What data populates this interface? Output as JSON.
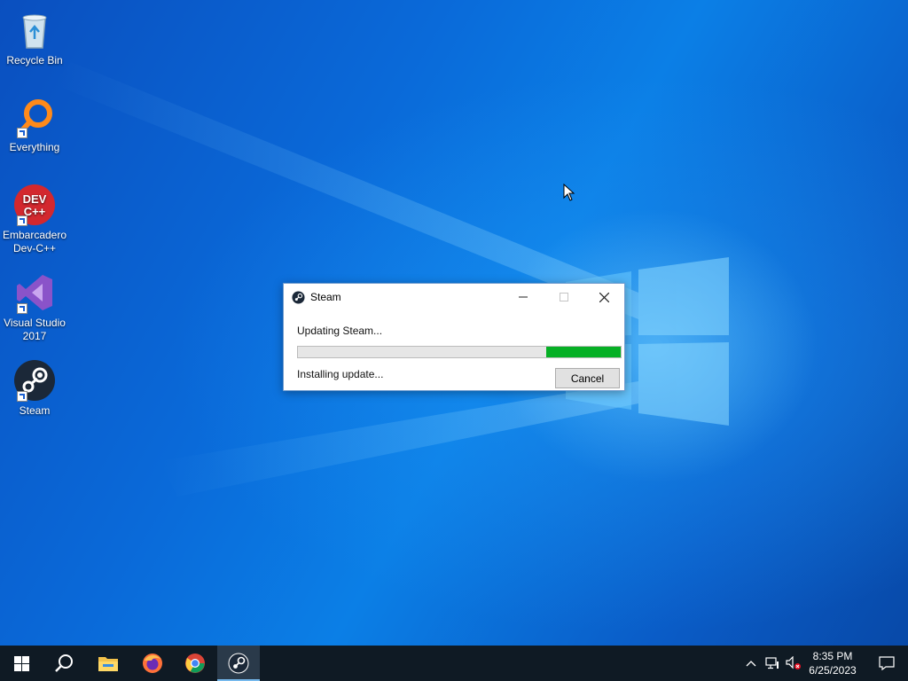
{
  "desktop": {
    "icons": [
      {
        "label": "Recycle Bin",
        "icon": "recycle-bin-icon"
      },
      {
        "label": "Everything",
        "icon": "everything-search-icon"
      },
      {
        "label": "Embarcadero Dev-C++",
        "icon": "devcpp-icon",
        "badge": "DEV C++"
      },
      {
        "label": "Visual Studio 2017",
        "icon": "visual-studio-icon"
      },
      {
        "label": "Steam",
        "icon": "steam-icon"
      }
    ]
  },
  "dialog": {
    "title": "Steam",
    "status": "Updating Steam...",
    "progress_percent": 23,
    "detail": "Installing update...",
    "cancel_label": "Cancel"
  },
  "taskbar": {
    "pinned": [
      "start-icon",
      "search-icon",
      "file-explorer-icon",
      "firefox-icon",
      "chrome-icon",
      "steam-icon"
    ],
    "clock": {
      "time": "8:35 PM",
      "date": "6/25/2023"
    }
  },
  "colors": {
    "progress": "#06b025",
    "taskbar": "#0f1a24",
    "accent": "#76b9ed"
  }
}
